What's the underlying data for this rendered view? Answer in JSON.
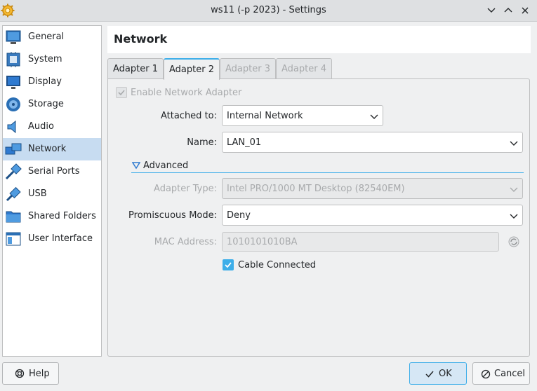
{
  "window": {
    "title": "ws11 (-p 2023) - Settings",
    "icon": "gear-icon"
  },
  "sidebar": {
    "items": [
      {
        "label": "General",
        "icon": "general-icon"
      },
      {
        "label": "System",
        "icon": "system-icon"
      },
      {
        "label": "Display",
        "icon": "display-icon"
      },
      {
        "label": "Storage",
        "icon": "storage-icon"
      },
      {
        "label": "Audio",
        "icon": "audio-icon"
      },
      {
        "label": "Network",
        "icon": "network-icon",
        "selected": true
      },
      {
        "label": "Serial Ports",
        "icon": "serial-ports-icon"
      },
      {
        "label": "USB",
        "icon": "usb-icon"
      },
      {
        "label": "Shared Folders",
        "icon": "shared-folders-icon"
      },
      {
        "label": "User Interface",
        "icon": "user-interface-icon"
      }
    ]
  },
  "page": {
    "title": "Network"
  },
  "tabs": [
    {
      "label": "Adapter 1",
      "state": "normal"
    },
    {
      "label": "Adapter 2",
      "state": "active"
    },
    {
      "label": "Adapter 3",
      "state": "disabled"
    },
    {
      "label": "Adapter 4",
      "state": "disabled"
    }
  ],
  "form": {
    "enable_label": "Enable Network Adapter",
    "attached_label": "Attached to:",
    "attached_value": "Internal Network",
    "name_label": "Name:",
    "name_value": "LAN_01",
    "advanced_label": "Advanced",
    "adapter_type_label": "Adapter Type:",
    "adapter_type_value": "Intel PRO/1000 MT Desktop (82540EM)",
    "promisc_label": "Promiscuous Mode:",
    "promisc_value": "Deny",
    "mac_label": "MAC Address:",
    "mac_value": "1010101010BA",
    "cable_label": "Cable Connected"
  },
  "buttons": {
    "help": "Help",
    "ok": "OK",
    "cancel": "Cancel"
  },
  "colors": {
    "accent": "#3daee9",
    "selection": "#c7dcf1"
  }
}
